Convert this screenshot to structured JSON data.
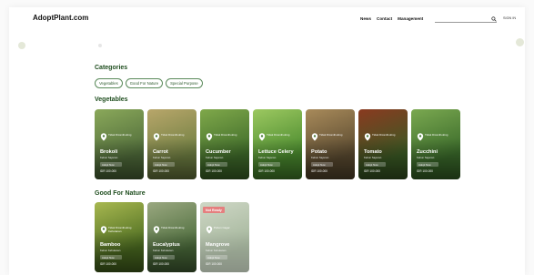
{
  "header": {
    "logo": "AdoptPlant.com",
    "nav": [
      "News",
      "Contact",
      "Management"
    ],
    "search_placeholder": "",
    "sign_in": "SIGN IN"
  },
  "categories": {
    "title": "Categories",
    "chips": [
      "Vegetables",
      "Good For Nature",
      "Special Purpose"
    ]
  },
  "vegetables": {
    "title": "Vegetables",
    "cards": [
      {
        "name": "Brokoli",
        "type": "Tidak Dicanthoking",
        "sub": "Kebun Sayuran",
        "button": "Adopt Now",
        "price": "IDR 100.000",
        "color1": "#4f6b3a",
        "color2": "#8aa85a"
      },
      {
        "name": "Carrot",
        "type": "Tidak Dicanthoking",
        "sub": "Kebun Sayuran",
        "button": "Adopt Now",
        "price": "IDR 100.000",
        "color1": "#6f7f42",
        "color2": "#b8a66a"
      },
      {
        "name": "Cucumber",
        "type": "Tidak Dicanthoking",
        "sub": "Kebun Sayuran",
        "button": "Adopt Now",
        "price": "IDR 100.000",
        "color1": "#3f6b2a",
        "color2": "#7fa84a"
      },
      {
        "name": "Lettuce Celery",
        "type": "Tidak Dicanthoking",
        "sub": "Kebun Sayuran",
        "button": "Adopt Now",
        "price": "IDR 100.000",
        "color1": "#4a8a2e",
        "color2": "#9cc860"
      },
      {
        "name": "Potato",
        "type": "Tidak Dicanthoking",
        "sub": "Kebun Sayuran",
        "button": "Adopt Now",
        "price": "IDR 100.000",
        "color1": "#5a4a30",
        "color2": "#a88a5a"
      },
      {
        "name": "Tomato",
        "type": "Tidak Dicanthoking",
        "sub": "Kebun Sayuran",
        "button": "Adopt Now",
        "price": "IDR 100.000",
        "color1": "#3a5a24",
        "color2": "#8a3a20"
      },
      {
        "name": "Zucchini",
        "type": "Tidak Dicanthoking",
        "sub": "Kebun Sayuran",
        "button": "Adopt Now",
        "price": "IDR 100.000",
        "color1": "#3a6a2a",
        "color2": "#7aa850"
      }
    ]
  },
  "nature": {
    "title": "Good For Nature",
    "cards": [
      {
        "name": "Bamboo",
        "type": "Tidak Dicanthoking Kehutanan",
        "sub": "Kebun Kehutanan",
        "button": "Adopt Now",
        "price": "IDR 100.000",
        "color1": "#4a6a20",
        "color2": "#a8b850",
        "badge": ""
      },
      {
        "name": "Eucalyptus",
        "type": "Tidak Dicanthoking",
        "sub": "Kebun Kehutanan",
        "button": "Adopt Now",
        "price": "IDR 100.000",
        "color1": "#4a6a3a",
        "color2": "#9aa880",
        "badge": ""
      },
      {
        "name": "Mangrove",
        "type": "Pohon Cagar",
        "sub": "Kebun Kehutanan",
        "button": "Adopt Now",
        "price": "IDR 100.000",
        "color1": "#5a7a4a",
        "color2": "#a8b898",
        "badge": "Not Ready"
      }
    ]
  }
}
